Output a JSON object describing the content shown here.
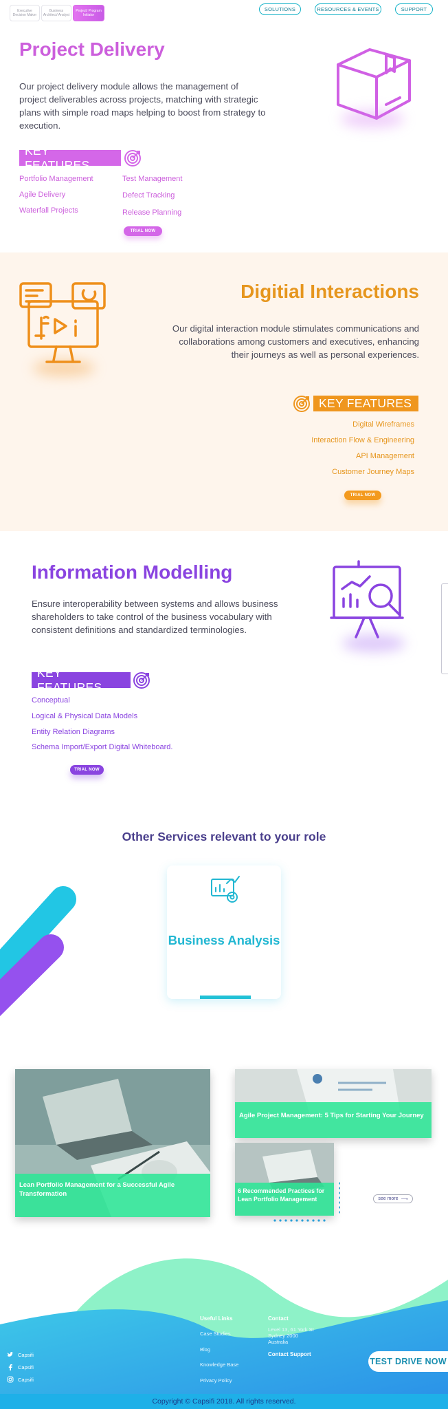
{
  "header": {
    "role_tabs": [
      {
        "label": "Executive Decision Maker"
      },
      {
        "label": "Business Architect/ Analyst"
      },
      {
        "label": "Project/ Program Initiator"
      }
    ],
    "nav": [
      {
        "label": "SOLUTIONS"
      },
      {
        "label": "RESOURCES & EVENTS"
      },
      {
        "label": "SUPPORT"
      }
    ]
  },
  "project_delivery": {
    "title": "Project Delivery",
    "description": "Our project delivery module allows the management of project deliverables across projects, matching with strategic plans with simple road maps helping to boost from strategy to execution.",
    "key_features_label": "KEY FEATURES",
    "features_left": [
      "Portfolio Management",
      "Agile Delivery",
      "Waterfall Projects"
    ],
    "features_right": [
      "Test Management",
      "Defect Tracking",
      "Release Planning"
    ],
    "trial_label": "TRIAL NOW",
    "accent": "#cc5fdc",
    "icon": "box-icon"
  },
  "digital_interactions": {
    "title": "Digitial Interactions",
    "description": "Our digital interaction module stimulates communications and collaborations among customers and executives, enhancing their journeys as well as personal experiences.",
    "key_features_label": "KEY FEATURES",
    "features": [
      "Digital Wireframes",
      "Interaction Flow & Engineering",
      "API Management",
      "Customer Journey Maps"
    ],
    "trial_label": "TRIAL NOW",
    "accent": "#e6961e",
    "icon": "monitor-icon"
  },
  "information_modelling": {
    "title": "Information Modelling",
    "description": "Ensure interoperability between systems and allows business shareholders to take control of the business vocabulary with consistent definitions and standardized terminologies.",
    "key_features_label": "KEY FEATURES",
    "features": [
      "Conceptual",
      "Logical & Physical Data Models",
      "Entity Relation Diagrams",
      "Schema Import/Export Digital Whiteboard."
    ],
    "trial_label": "TRIAL NOW",
    "accent": "#8a44e0",
    "icon": "presentation-icon"
  },
  "other_services": {
    "title": "Other Services relevant to your role",
    "card_title": "Business Analysis",
    "icon": "analytics-icon"
  },
  "blog": {
    "posts": [
      {
        "title": "Lean Portfolio Management for a Successful Agile Transformation"
      },
      {
        "title": "Agile Project Management: 5 Tips for Starting Your Journey"
      },
      {
        "title": "6 Recommended Practices for Lean Portfolio Management"
      }
    ],
    "see_more": "see more"
  },
  "footer": {
    "useful_links_heading": "Useful Links",
    "useful_links": [
      "Case Studies",
      "Blog",
      "Knowledge Base",
      "Privacy Policy"
    ],
    "contact_heading": "Contact",
    "address_lines": [
      "Level 13, 61 York St",
      "Sydney 2000",
      "Australia"
    ],
    "contact_support": "Contact Support",
    "social": [
      {
        "icon": "twitter-icon",
        "label": "Capsifi"
      },
      {
        "icon": "facebook-icon",
        "label": "Capsifi"
      },
      {
        "icon": "instagram-icon",
        "label": "Capsifi"
      }
    ],
    "test_drive": "TEST DRIVE NOW",
    "copyright_prefix": "Copyright © ",
    "copyright_brand": "Capsifi 2018. All rights reserved."
  }
}
